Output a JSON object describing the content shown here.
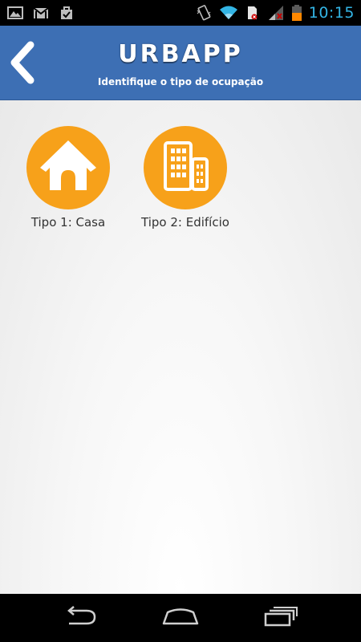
{
  "status_bar": {
    "time": "10:15",
    "left_icons": [
      "gallery-icon",
      "gmail-icon",
      "download-check-icon"
    ],
    "right_icons": [
      "vibrate-icon",
      "wifi-icon",
      "sim-icon",
      "signal-icon",
      "battery-icon"
    ]
  },
  "header": {
    "title": "URBAPP",
    "subtitle": "Identifique o tipo de ocupação",
    "back_icon": "chevron-left-icon",
    "color": "#3d6fb4"
  },
  "options": [
    {
      "label": "Tipo 1: Casa",
      "icon": "house-icon"
    },
    {
      "label": "Tipo 2: Edifício",
      "icon": "building-icon"
    }
  ],
  "colors": {
    "accent": "#f7a11a",
    "clock": "#33b5e5"
  },
  "nav_bar": {
    "icons": [
      "nav-back-icon",
      "nav-home-icon",
      "nav-recent-apps-icon"
    ]
  }
}
